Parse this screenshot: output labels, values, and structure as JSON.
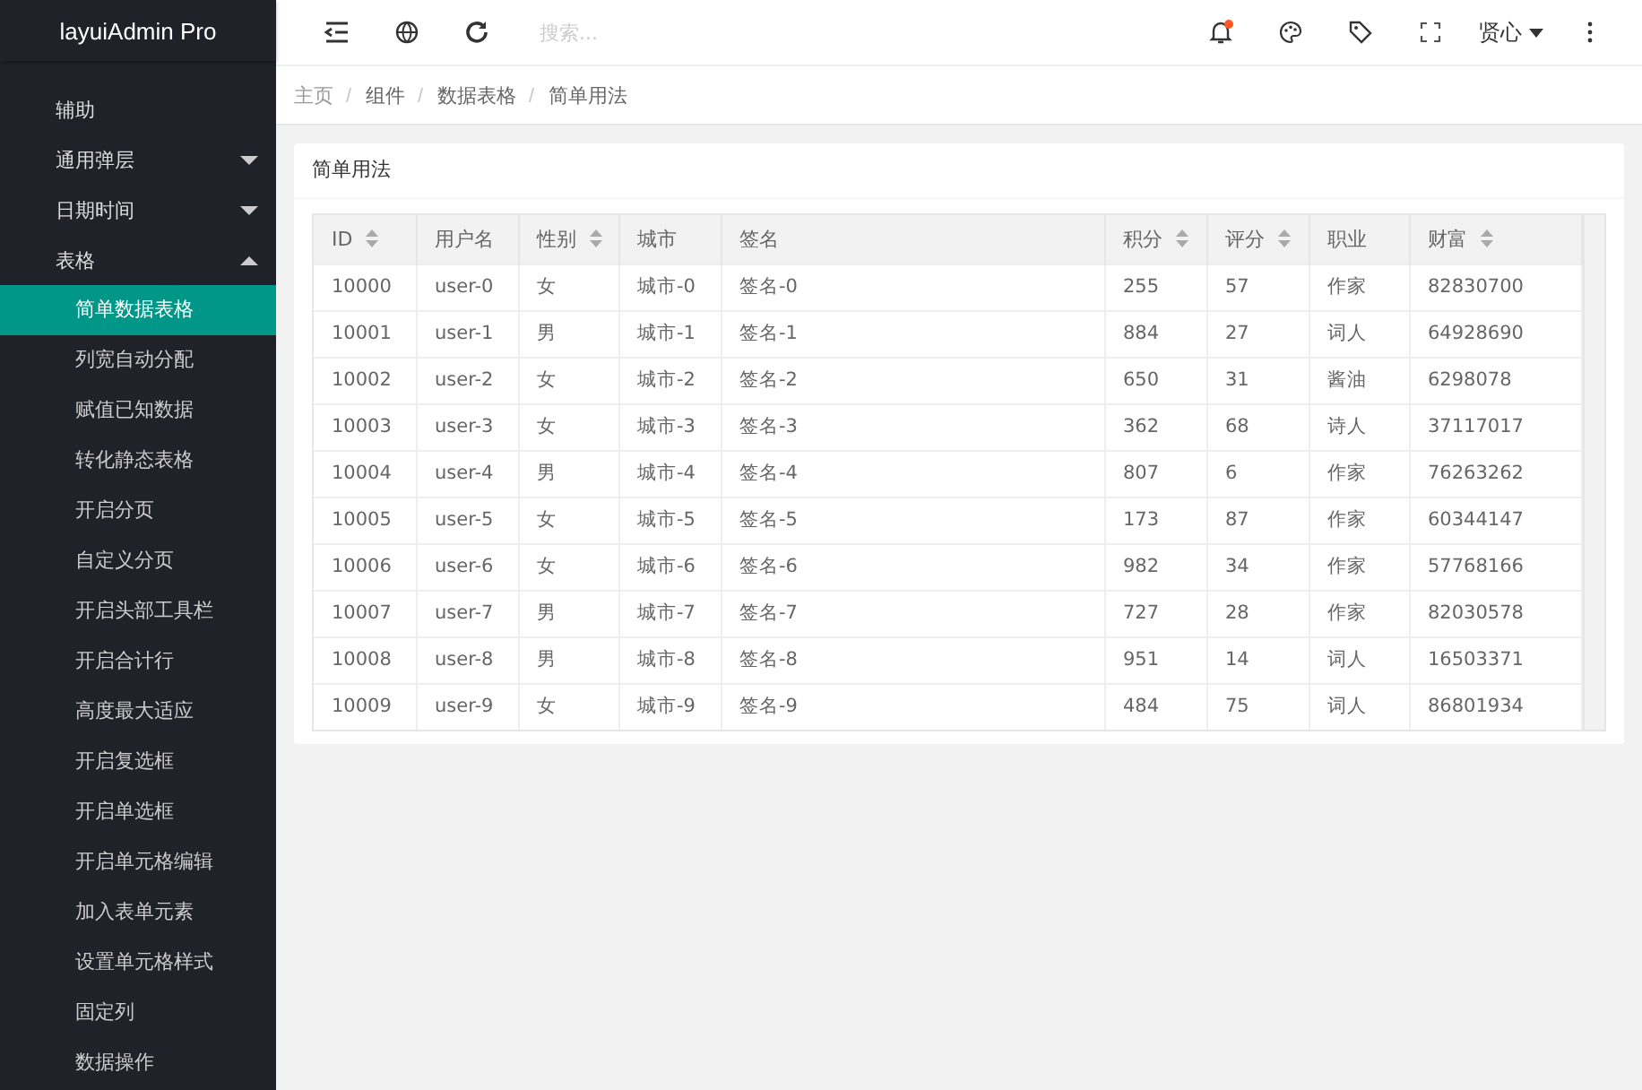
{
  "logo": "layuiAdmin Pro",
  "toolbar": {
    "left": [
      {
        "kind": "shrink"
      },
      {
        "kind": "globe"
      },
      {
        "kind": "refresh"
      }
    ],
    "search": {
      "placeholder": "搜索..."
    },
    "right": [
      {
        "kind": "bell",
        "has_new": true
      },
      {
        "kind": "palette",
        "has_new": false
      },
      {
        "kind": "tag",
        "has_new": false
      },
      {
        "kind": "fullscreen",
        "has_new": false
      }
    ],
    "user": "贤心"
  },
  "sidebar": {
    "items": [
      {
        "label": "辅助"
      },
      {
        "label": "通用弹层",
        "expanded": false
      },
      {
        "label": "日期时间",
        "expanded": false
      },
      {
        "label": "表格",
        "expanded": true,
        "children": [
          {
            "label": "简单数据表格",
            "selected": true
          },
          {
            "label": "列宽自动分配",
            "selected": false
          },
          {
            "label": "赋值已知数据",
            "selected": false
          },
          {
            "label": "转化静态表格",
            "selected": false
          },
          {
            "label": "开启分页",
            "selected": false
          },
          {
            "label": "自定义分页",
            "selected": false
          },
          {
            "label": "开启头部工具栏",
            "selected": false
          },
          {
            "label": "开启合计行",
            "selected": false
          },
          {
            "label": "高度最大适应",
            "selected": false
          },
          {
            "label": "开启复选框",
            "selected": false
          },
          {
            "label": "开启单选框",
            "selected": false
          },
          {
            "label": "开启单元格编辑",
            "selected": false
          },
          {
            "label": "加入表单元素",
            "selected": false
          },
          {
            "label": "设置单元格样式",
            "selected": false
          },
          {
            "label": "固定列",
            "selected": false
          },
          {
            "label": "数据操作",
            "selected": false
          }
        ]
      }
    ]
  },
  "breadcrumb": [
    "主页",
    "组件",
    "数据表格",
    "简单用法"
  ],
  "card": {
    "title": "简单用法",
    "table": {
      "columns": [
        {
          "label": "ID",
          "sortable": true
        },
        {
          "label": "用户名",
          "sortable": false
        },
        {
          "label": "性别",
          "sortable": true
        },
        {
          "label": "城市",
          "sortable": false
        },
        {
          "label": "签名",
          "sortable": false
        },
        {
          "label": "积分",
          "sortable": true
        },
        {
          "label": "评分",
          "sortable": true
        },
        {
          "label": "职业",
          "sortable": false
        },
        {
          "label": "财富",
          "sortable": true
        }
      ],
      "rows": [
        [
          "10000",
          "user-0",
          "女",
          "城市-0",
          "签名-0",
          "255",
          "57",
          "作家",
          "82830700"
        ],
        [
          "10001",
          "user-1",
          "男",
          "城市-1",
          "签名-1",
          "884",
          "27",
          "词人",
          "64928690"
        ],
        [
          "10002",
          "user-2",
          "女",
          "城市-2",
          "签名-2",
          "650",
          "31",
          "酱油",
          "6298078"
        ],
        [
          "10003",
          "user-3",
          "女",
          "城市-3",
          "签名-3",
          "362",
          "68",
          "诗人",
          "37117017"
        ],
        [
          "10004",
          "user-4",
          "男",
          "城市-4",
          "签名-4",
          "807",
          "6",
          "作家",
          "76263262"
        ],
        [
          "10005",
          "user-5",
          "女",
          "城市-5",
          "签名-5",
          "173",
          "87",
          "作家",
          "60344147"
        ],
        [
          "10006",
          "user-6",
          "女",
          "城市-6",
          "签名-6",
          "982",
          "34",
          "作家",
          "57768166"
        ],
        [
          "10007",
          "user-7",
          "男",
          "城市-7",
          "签名-7",
          "727",
          "28",
          "作家",
          "82030578"
        ],
        [
          "10008",
          "user-8",
          "男",
          "城市-8",
          "签名-8",
          "951",
          "14",
          "词人",
          "16503371"
        ],
        [
          "10009",
          "user-9",
          "女",
          "城市-9",
          "签名-9",
          "484",
          "75",
          "词人",
          "86801934"
        ]
      ]
    }
  }
}
